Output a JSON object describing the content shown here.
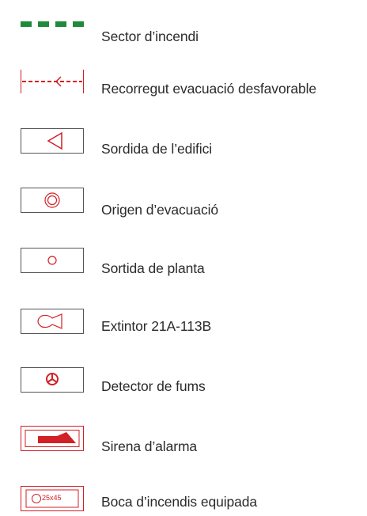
{
  "legend": {
    "items": [
      {
        "icon": "fire-sector-line-icon",
        "label": "Sector d’incendi",
        "color": "#1f8a3b"
      },
      {
        "icon": "evacuation-route-arrow-icon",
        "label": "Recorregut evacuació desfavorable",
        "color": "#d31f26"
      },
      {
        "icon": "building-exit-triangle-icon",
        "label": "Sordida de l’edifici",
        "color": "#d31f26"
      },
      {
        "icon": "evacuation-origin-circles-icon",
        "label": "Origen d’evacuació",
        "color": "#d31f26"
      },
      {
        "icon": "floor-exit-circle-icon",
        "label": "Sortida de planta",
        "color": "#d31f26"
      },
      {
        "icon": "extinguisher-icon",
        "label": "Extintor 21A-113B",
        "color": "#d31f26"
      },
      {
        "icon": "smoke-detector-icon",
        "label": "Detector de fums",
        "color": "#d31f26"
      },
      {
        "icon": "alarm-siren-icon",
        "label": "Sirena d’alarma",
        "color": "#d31f26"
      },
      {
        "icon": "fire-hose-box-icon",
        "label": "Boca d’incendis equipada",
        "color": "#d31f26",
        "symbol_text": "25x45"
      }
    ]
  }
}
